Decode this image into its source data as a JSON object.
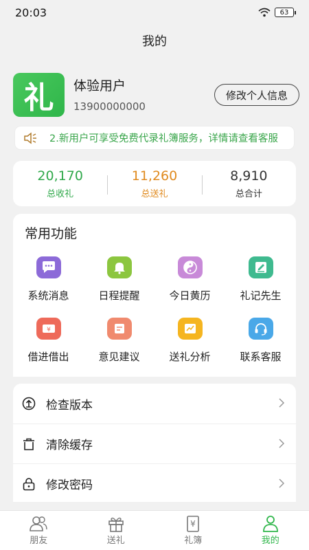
{
  "status_bar": {
    "time": "20:03",
    "battery": "63"
  },
  "header": {
    "title": "我的"
  },
  "profile": {
    "avatar_text": "礼",
    "name": "体验用户",
    "phone": "13900000000",
    "edit_label": "修改个人信息"
  },
  "notice": {
    "text": "2.新用户可享受免费代录礼簿服务，详情请查看客服"
  },
  "stats": [
    {
      "value": "20,170",
      "label": "总收礼",
      "color": "#2fa84a"
    },
    {
      "value": "11,260",
      "label": "总送礼",
      "color": "#e08a1e"
    },
    {
      "value": "8,910",
      "label": "总合计",
      "color": "#333333"
    }
  ],
  "features": {
    "title": "常用功能",
    "items": [
      {
        "label": "系统消息",
        "icon": "message-icon"
      },
      {
        "label": "日程提醒",
        "icon": "bell-icon"
      },
      {
        "label": "今日黄历",
        "icon": "yin-yang-icon"
      },
      {
        "label": "礼记先生",
        "icon": "note-edit-icon"
      },
      {
        "label": "借进借出",
        "icon": "money-note-icon"
      },
      {
        "label": "意见建议",
        "icon": "feedback-icon"
      },
      {
        "label": "送礼分析",
        "icon": "chart-icon"
      },
      {
        "label": "联系客服",
        "icon": "headset-icon"
      }
    ]
  },
  "settings": [
    {
      "label": "检查版本",
      "icon": "upload-icon"
    },
    {
      "label": "清除缓存",
      "icon": "trash-icon"
    },
    {
      "label": "修改密码",
      "icon": "lock-icon"
    }
  ],
  "bottom_nav": [
    {
      "label": "朋友",
      "icon": "friends-icon",
      "active": false
    },
    {
      "label": "送礼",
      "icon": "gift-icon",
      "active": false
    },
    {
      "label": "礼簿",
      "icon": "ledger-icon",
      "active": false
    },
    {
      "label": "我的",
      "icon": "user-icon",
      "active": true
    }
  ],
  "colors": {
    "brand_green": "#2fb64a",
    "orange": "#e08a1e"
  }
}
